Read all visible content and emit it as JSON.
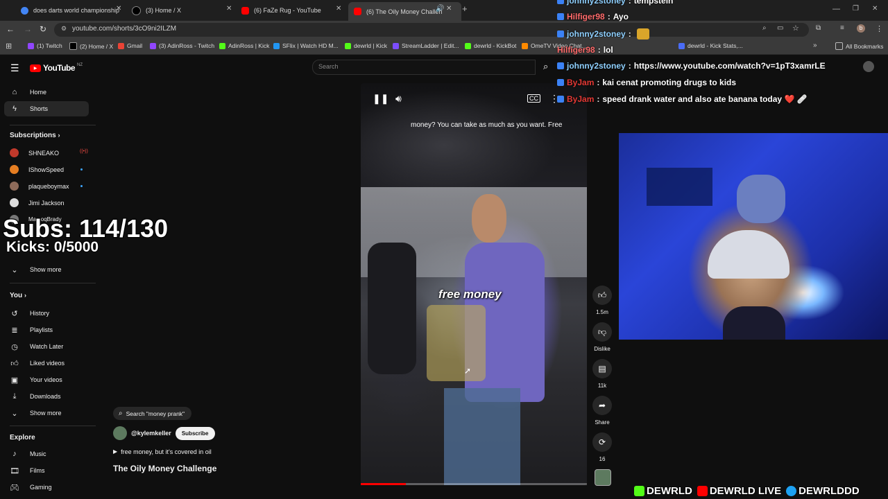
{
  "browser": {
    "tabs": [
      {
        "title": "does darts world championship",
        "color": "#4285f4"
      },
      {
        "title": "(3) Home / X",
        "color": "#000000"
      },
      {
        "title": "(6) FaZe Rug - YouTube",
        "color": "#ff0000"
      },
      {
        "title": "(6) The Oily Money Challen",
        "color": "#ff0000"
      }
    ],
    "url": "youtube.com/shorts/3cO9ni2ILZM",
    "bookmarks": [
      {
        "label": "(1) Twitch",
        "color": "#9146ff"
      },
      {
        "label": "(2) Home / X",
        "color": "#000000"
      },
      {
        "label": "Gmail",
        "color": "#ea4335"
      },
      {
        "label": "(3) AdinRoss - Twitch",
        "color": "#9146ff"
      },
      {
        "label": "AdinRoss | Kick",
        "color": "#53fc18"
      },
      {
        "label": "SFlix | Watch HD M...",
        "color": "#2196f3"
      },
      {
        "label": "dewrld | Kick",
        "color": "#53fc18"
      },
      {
        "label": "StreamLadder | Edit...",
        "color": "#7c4dff"
      },
      {
        "label": "dewrld - KickBot",
        "color": "#53fc18"
      },
      {
        "label": "OmeTV Video Chat...",
        "color": "#ff8a00"
      },
      {
        "label": "dewrld - Kick Stats,...",
        "color": "#4a6cf7"
      }
    ],
    "all_bookmarks": "All Bookmarks"
  },
  "youtube": {
    "logo_text": "YouTube",
    "logo_region": "NZ",
    "search_placeholder": "Search",
    "nav": [
      {
        "label": "Home",
        "icon": "home-icon"
      },
      {
        "label": "Shorts",
        "icon": "shorts-icon"
      }
    ],
    "subscriptions_title": "Subscriptions",
    "subscriptions": [
      {
        "name": "SHNEAKO",
        "color": "#c0392b"
      },
      {
        "name": "IShowSpeed",
        "color": "#e67e22"
      },
      {
        "name": "plaqueboymax",
        "color": "#8e6b5a"
      },
      {
        "name": "Jimi Jackson",
        "color": "#dddddd"
      },
      {
        "name": "MarcoqBrady",
        "color": "#777777"
      }
    ],
    "show_more": "Show more",
    "you_title": "You",
    "you_items": [
      {
        "label": "History",
        "icon": "history-icon"
      },
      {
        "label": "Playlists",
        "icon": "playlists-icon"
      },
      {
        "label": "Watch Later",
        "icon": "watch-later-icon"
      },
      {
        "label": "Liked videos",
        "icon": "thumbs-up-icon"
      },
      {
        "label": "Your videos",
        "icon": "your-videos-icon"
      },
      {
        "label": "Downloads",
        "icon": "download-icon"
      }
    ],
    "explore_title": "Explore",
    "explore_items": [
      {
        "label": "Music",
        "icon": "music-icon"
      },
      {
        "label": "Films",
        "icon": "films-icon"
      },
      {
        "label": "Gaming",
        "icon": "gaming-icon"
      }
    ],
    "short": {
      "search_chip": "Search \"money prank\"",
      "channel": "@kylemkeller",
      "subscribe": "Subscribe",
      "description": "free money, but it's covered in oil",
      "title": "The Oily Money Challenge",
      "caption": "money? You can take as much as you want. Free",
      "overlay_text": "free money",
      "progress": 0.2,
      "actions": [
        {
          "label": "1.5m",
          "icon": "thumbs-up-icon"
        },
        {
          "label": "Dislike",
          "icon": "thumbs-down-icon"
        },
        {
          "label": "11k",
          "icon": "comment-icon"
        },
        {
          "label": "Share",
          "icon": "share-icon"
        },
        {
          "label": "16",
          "icon": "remix-icon"
        }
      ]
    }
  },
  "stream": {
    "subs": "Subs: 114/130",
    "kicks": "Kicks: 0/5000",
    "chat": [
      {
        "user": "johnny2stoney",
        "msg": "tempstein",
        "color": "#8fd0ff"
      },
      {
        "user": "Hilfiger98",
        "msg": "Ayo",
        "color": "#ff6b6b"
      },
      {
        "user": "johnny2stoney",
        "msg": "",
        "color": "#8fd0ff"
      },
      {
        "user": "Hilfiger98",
        "msg": "lol",
        "color": "#ff6b6b"
      },
      {
        "user": "johnny2stoney",
        "msg": "https://www.youtube.com/watch?v=1pT3xamrLE",
        "color": "#8fd0ff"
      },
      {
        "user": "ByJam",
        "msg": "kai cenat promoting drugs to kids",
        "color": "#e53935"
      },
      {
        "user": "ByJam",
        "msg": "speed drank water and also ate banana today ❤️ 🩹",
        "color": "#e53935"
      }
    ],
    "socials": [
      {
        "handle": "DEWRLD",
        "color": "#53fc18"
      },
      {
        "handle": "DEWRLD LIVE",
        "color": "#ff0000"
      },
      {
        "handle": "DEWRLDDD",
        "color": "#1da1f2"
      }
    ]
  }
}
